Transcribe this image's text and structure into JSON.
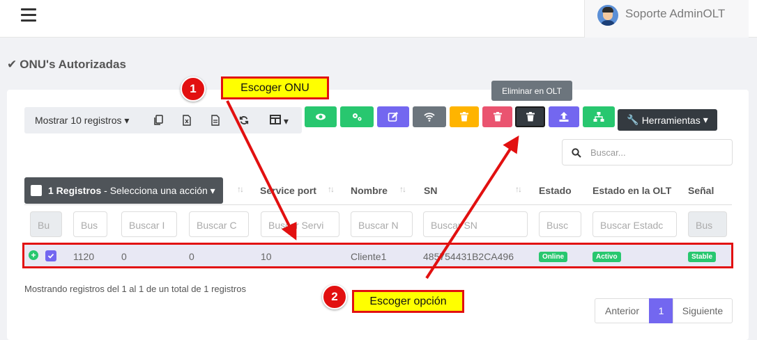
{
  "header": {
    "user_name": "Soporte AdminOLT"
  },
  "page": {
    "title": "ONU's Autorizadas"
  },
  "toolbar": {
    "show_records": "Mostrar 10 registros",
    "tooltip": "Eliminar en OLT",
    "tools_label": "Herramientas"
  },
  "action_buttons": [
    {
      "icon": "eye-icon",
      "color": "#28c76f"
    },
    {
      "icon": "gears-icon",
      "color": "#28c76f"
    },
    {
      "icon": "edit-icon",
      "color": "#7367f0"
    },
    {
      "icon": "wifi-icon",
      "color": "#6c757d"
    },
    {
      "icon": "trash-icon",
      "color": "#ffb400"
    },
    {
      "icon": "trash-icon",
      "color": "#ea5470"
    },
    {
      "icon": "trash-icon",
      "color": "#343a40"
    },
    {
      "icon": "upload-icon",
      "color": "#7367f0"
    },
    {
      "icon": "sitemap-icon",
      "color": "#28c76f"
    }
  ],
  "search": {
    "placeholder": "Buscar..."
  },
  "selection": {
    "count_label": "1 Registros",
    "action_label": "- Selecciona una acción"
  },
  "table": {
    "headers": [
      "Service port",
      "Nombre",
      "SN",
      "Estado",
      "Estado en la OLT",
      "Señal"
    ],
    "filters": [
      "Bu",
      "Bus",
      "Buscar I",
      "Buscar C",
      "Buscar Servi",
      "Buscar N",
      "Buscar SN",
      "Busc",
      "Buscar Estadc",
      "Bus"
    ],
    "row": {
      "id": "1120",
      "col2": "0",
      "col3": "0",
      "service_port": "10",
      "nombre": "Cliente1",
      "sn": "485754431B2CA496",
      "estado": "Online",
      "estado_olt": "Activo",
      "senal": "Stable"
    }
  },
  "footer": {
    "info": "Mostrando registros del 1 al 1 de un total de 1 registros",
    "prev": "Anterior",
    "page": "1",
    "next": "Siguiente"
  },
  "annotations": {
    "step1_number": "1",
    "step1_label": "Escoger ONU",
    "step2_number": "2",
    "step2_label": "Escoger opción",
    "color": "#e21010",
    "callout_bg": "#ffff00"
  }
}
